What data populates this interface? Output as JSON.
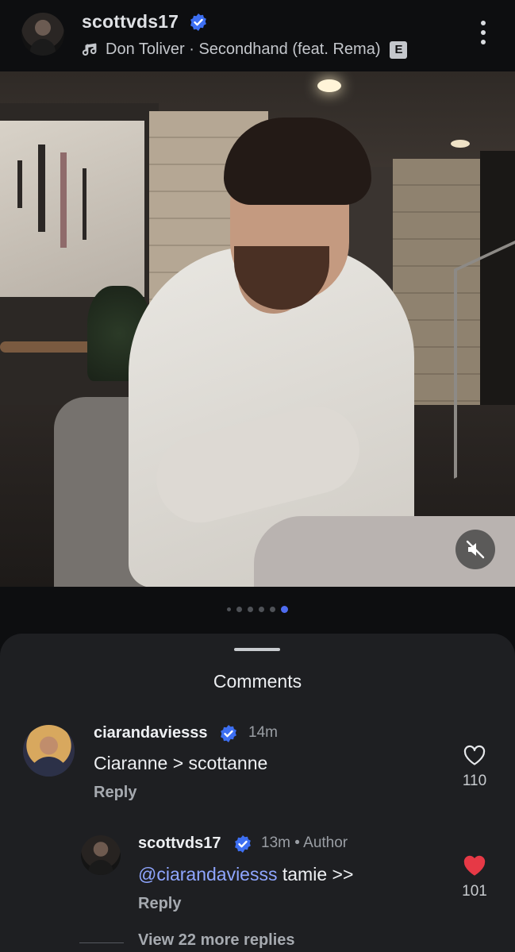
{
  "post": {
    "username": "scottvds17",
    "music": {
      "text": "Don Toliver · Secondhand (feat. Rema)",
      "explicit_badge": "E"
    },
    "carousel": {
      "count": 6,
      "active_index": 5
    }
  },
  "comments_sheet": {
    "title": "Comments",
    "comments": [
      {
        "username": "ciarandaviesss",
        "time": "14m",
        "text": "Ciaranne > scottanne",
        "reply_label": "Reply",
        "likes": "110",
        "liked": false
      }
    ],
    "replies": [
      {
        "username": "scottvds17",
        "time": "13m",
        "author_label": "Author",
        "mention": "@ciarandaviesss",
        "text": " tamie >>",
        "reply_label": "Reply",
        "likes": "101",
        "liked": true
      }
    ],
    "view_more": "View 22 more replies"
  },
  "colors": {
    "verified": "#3d6ff2",
    "like_red": "#e63946",
    "mention": "#8fa6ff",
    "carousel_active": "#4e6cf0"
  }
}
